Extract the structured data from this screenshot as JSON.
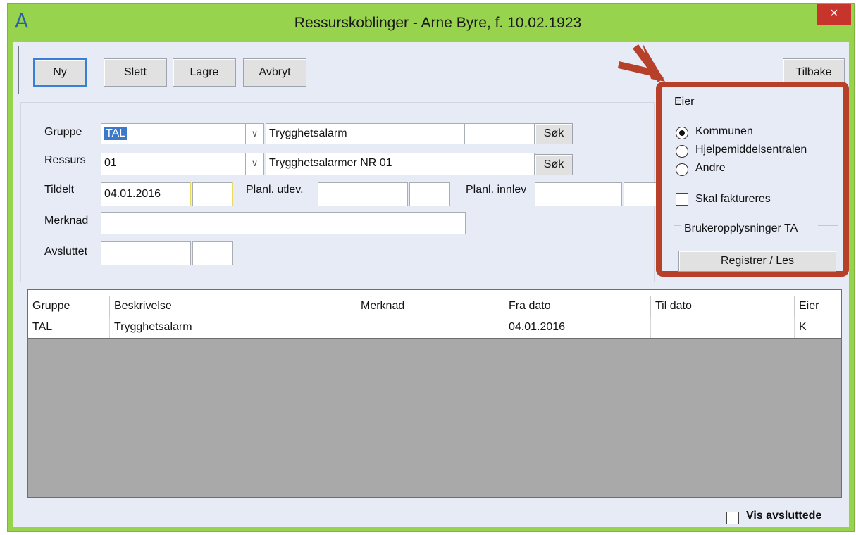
{
  "window": {
    "title": "Ressurskoblinger - Arne Byre,  f. 10.02.1923",
    "app_icon": "A",
    "close_label": "×"
  },
  "toolbar": {
    "new_label": "Ny",
    "delete_label": "Slett",
    "save_label": "Lagre",
    "cancel_label": "Avbryt",
    "back_label": "Tilbake"
  },
  "form": {
    "gruppe_label": "Gruppe",
    "gruppe_code": "TAL",
    "gruppe_description": "Trygghetsalarm",
    "gruppe_extra": "",
    "ressurs_label": "Ressurs",
    "ressurs_code": "01",
    "ressurs_description": "Trygghetsalarmer NR 01",
    "search_label": "Søk",
    "tildelt_label": "Tildelt",
    "tildelt_date": "04.01.2016",
    "tildelt_time": "",
    "planl_utlev_label": "Planl. utlev.",
    "planl_utlev_date": "",
    "planl_utlev_time": "",
    "planl_innlev_label": "Planl. innlev",
    "planl_innlev_date": "",
    "planl_innlev_time": "",
    "merknad_label": "Merknad",
    "merknad_value": "",
    "avsluttet_label": "Avsluttet",
    "avsluttet_date": "",
    "avsluttet_time": ""
  },
  "eier": {
    "group_label": "Eier",
    "options": [
      {
        "label": "Kommunen",
        "selected": true
      },
      {
        "label": "Hjelpemiddelsentralen",
        "selected": false
      },
      {
        "label": "Andre",
        "selected": false
      }
    ],
    "invoice_label": "Skal faktureres",
    "invoice_checked": false,
    "info_label": "Brukeropplysninger TA",
    "register_label": "Registrer / Les",
    "highlight_color": "#b6402a"
  },
  "grid": {
    "columns": [
      "Gruppe",
      "Beskrivelse",
      "Merknad",
      "Fra dato",
      "Til dato",
      "Eier"
    ],
    "rows": [
      [
        "TAL",
        "Trygghetsalarm",
        "",
        "04.01.2016",
        "",
        "K"
      ]
    ]
  },
  "footer": {
    "show_closed_label": "Vis avsluttede",
    "show_closed_checked": false
  },
  "colors": {
    "frame": "#98d34e",
    "client": "#e7ebf6",
    "close": "#c7342c",
    "selection": "#3b79cc"
  }
}
